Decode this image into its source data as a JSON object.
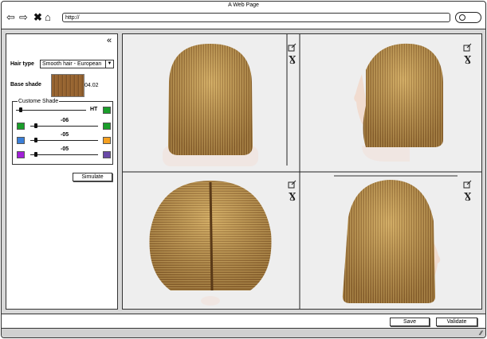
{
  "window": {
    "title": "A Web Page"
  },
  "browser": {
    "url": "http://"
  },
  "panel": {
    "hair_type_label": "Hair type",
    "hair_type_value": "Smooth hair - European",
    "base_shade_label": "Base shade",
    "base_shade_code": "04.02",
    "custom_shade_legend": "Custome Shade",
    "sliders": [
      {
        "value": "HT",
        "left_color": null,
        "right_color": "#1a9e2a",
        "position": 0.05
      },
      {
        "value": "-06",
        "left_color": "#1a9e2a",
        "right_color": "#1a9e2a",
        "position": 0.05
      },
      {
        "value": "-05",
        "left_color": "#3a7fd8",
        "right_color": "#f5a020",
        "position": 0.05
      },
      {
        "value": "-05",
        "left_color": "#a21fd8",
        "right_color": "#6a4aa8",
        "position": 0.05
      }
    ],
    "simulate_label": "Simulate"
  },
  "views": [
    {
      "name": "back",
      "open_icon": "external-link-icon",
      "pin_icon": "pin-icon"
    },
    {
      "name": "side-left",
      "open_icon": "external-link-icon",
      "pin_icon": "pin-icon"
    },
    {
      "name": "top",
      "open_icon": "external-link-icon",
      "pin_icon": "pin-icon"
    },
    {
      "name": "side-right",
      "open_icon": "external-link-icon",
      "pin_icon": "pin-icon"
    }
  ],
  "footer": {
    "save_label": "Save",
    "validate_label": "Validate"
  },
  "colors": {
    "hair_light": "#c9a25a",
    "hair_mid": "#a8793a",
    "hair_dark": "#7a5224",
    "viewer_bg": "#eeeeee"
  }
}
